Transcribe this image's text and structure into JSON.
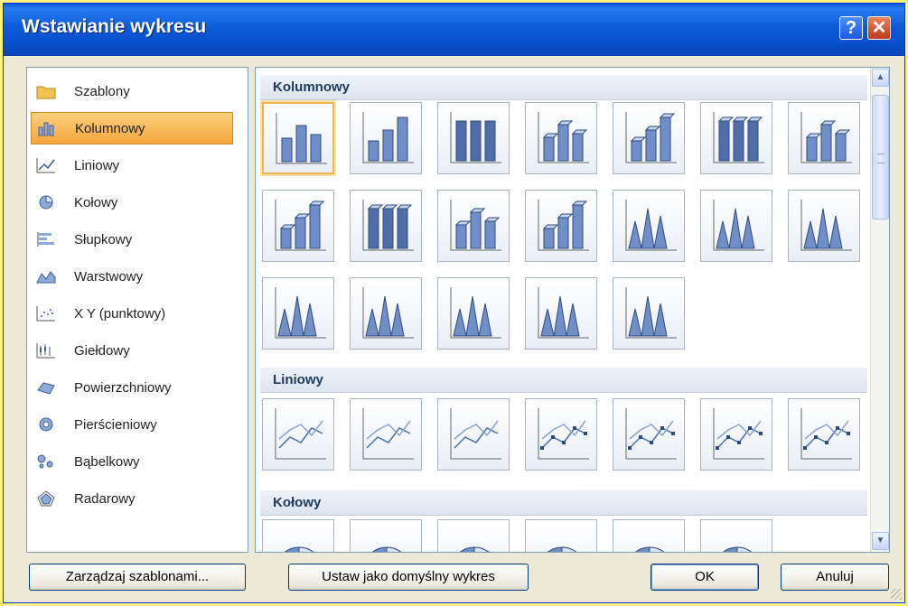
{
  "window": {
    "title": "Wstawianie wykresu",
    "help_label": "?",
    "close_label": "✕"
  },
  "categories": [
    {
      "label": "Szablony",
      "icon": "folder-icon"
    },
    {
      "label": "Kolumnowy",
      "icon": "column-chart-icon",
      "selected": true
    },
    {
      "label": "Liniowy",
      "icon": "line-chart-icon"
    },
    {
      "label": "Kołowy",
      "icon": "pie-chart-icon"
    },
    {
      "label": "Słupkowy",
      "icon": "bar-chart-icon"
    },
    {
      "label": "Warstwowy",
      "icon": "area-chart-icon"
    },
    {
      "label": "X Y (punktowy)",
      "icon": "scatter-chart-icon"
    },
    {
      "label": "Giełdowy",
      "icon": "stock-chart-icon"
    },
    {
      "label": "Powierzchniowy",
      "icon": "surface-chart-icon"
    },
    {
      "label": "Pierścieniowy",
      "icon": "doughnut-chart-icon"
    },
    {
      "label": "Bąbelkowy",
      "icon": "bubble-chart-icon"
    },
    {
      "label": "Radarowy",
      "icon": "radar-chart-icon"
    }
  ],
  "sections": [
    {
      "title": "Kolumnowy",
      "tile_count": 19,
      "selected_tile": 0
    },
    {
      "title": "Liniowy",
      "tile_count": 7
    },
    {
      "title": "Kołowy",
      "tile_count": 6
    }
  ],
  "buttons": {
    "manage_templates": "Zarządzaj szablonami...",
    "set_default": "Ustaw jako domyślny wykres",
    "ok": "OK",
    "cancel": "Anuluj"
  },
  "colors": {
    "accent": "#f6a63b",
    "chart_blue": "#6f8fc6",
    "titlebar": "#0a5fe0"
  }
}
